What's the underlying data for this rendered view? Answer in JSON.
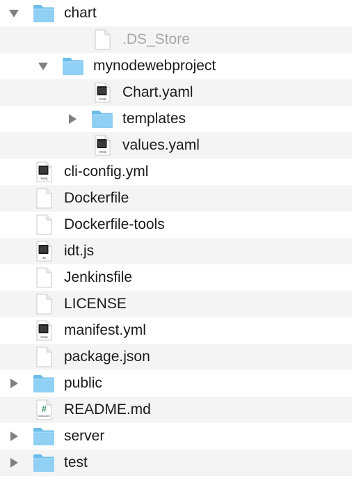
{
  "tree": {
    "rows": [
      {
        "name": "chart",
        "kind": "folder",
        "disclosure": "expanded",
        "depth": 0
      },
      {
        "name": ".DS_Store",
        "kind": "blank-file",
        "disclosure": "none",
        "depth": 2,
        "dimmed": true
      },
      {
        "name": "mynodewebproject",
        "kind": "folder",
        "disclosure": "expanded",
        "depth": 1
      },
      {
        "name": "Chart.yaml",
        "kind": "yaml-file",
        "badge": "YAML",
        "disclosure": "none",
        "depth": 2
      },
      {
        "name": "templates",
        "kind": "folder",
        "disclosure": "collapsed",
        "depth": 2
      },
      {
        "name": "values.yaml",
        "kind": "yaml-file",
        "badge": "YAML",
        "disclosure": "none",
        "depth": 2
      },
      {
        "name": "cli-config.yml",
        "kind": "yaml-file",
        "badge": "YAML",
        "disclosure": "none",
        "depth": 0
      },
      {
        "name": "Dockerfile",
        "kind": "blank-file",
        "disclosure": "none",
        "depth": 0
      },
      {
        "name": "Dockerfile-tools",
        "kind": "blank-file",
        "disclosure": "none",
        "depth": 0
      },
      {
        "name": "idt.js",
        "kind": "js-file",
        "badge": "JS",
        "disclosure": "none",
        "depth": 0
      },
      {
        "name": "Jenkinsfile",
        "kind": "blank-file",
        "disclosure": "none",
        "depth": 0
      },
      {
        "name": "LICENSE",
        "kind": "blank-file",
        "disclosure": "none",
        "depth": 0
      },
      {
        "name": "manifest.yml",
        "kind": "yaml-file",
        "badge": "YAML",
        "disclosure": "none",
        "depth": 0
      },
      {
        "name": "package.json",
        "kind": "blank-file",
        "disclosure": "none",
        "depth": 0
      },
      {
        "name": "public",
        "kind": "folder",
        "disclosure": "collapsed",
        "depth": 0
      },
      {
        "name": "README.md",
        "kind": "markdown-file",
        "glyph": "#",
        "badge": "Markdown",
        "disclosure": "none",
        "depth": 0
      },
      {
        "name": "server",
        "kind": "folder",
        "disclosure": "collapsed",
        "depth": 0
      },
      {
        "name": "test",
        "kind": "folder",
        "disclosure": "collapsed",
        "depth": 0
      }
    ]
  },
  "colors": {
    "row_alt": "#f4f4f5",
    "text": "#1a1a1a",
    "text_dimmed": "#a8a8a8",
    "folder_front": "#8fd0f4",
    "folder_back": "#6cbde9",
    "disclosure": "#808080"
  }
}
